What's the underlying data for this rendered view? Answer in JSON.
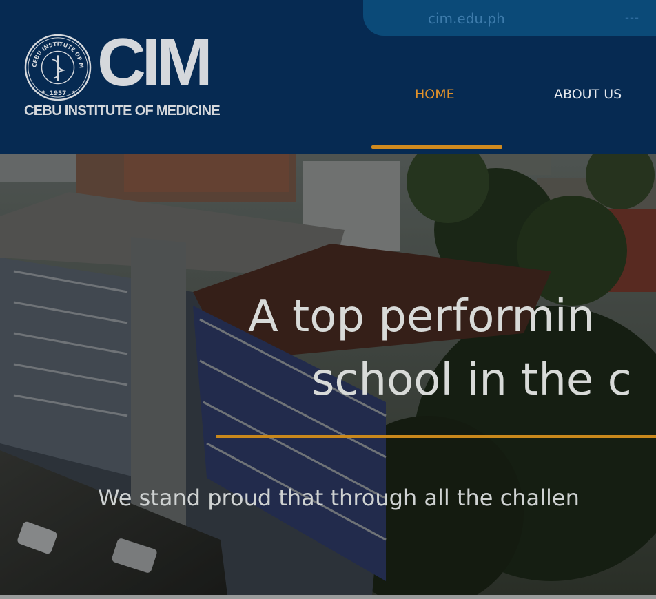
{
  "topbar": {
    "domain": "cim.edu.ph",
    "extra": "---"
  },
  "logo": {
    "brand": "CIM",
    "subtitle": "CEBU INSTITUTE OF MEDICINE",
    "seal_text": "CEBU INSTITUTE OF MEDICINE",
    "seal_year": "1957"
  },
  "nav": {
    "items": [
      {
        "label": "HOME",
        "active": true
      },
      {
        "label": "ABOUT US",
        "active": false
      }
    ]
  },
  "hero": {
    "title_line1": "A top performin",
    "title_line2": "school in the c",
    "subtitle": "We stand proud that through all the challen"
  },
  "colors": {
    "header_bg": "#062a52",
    "accent": "#d08a1f",
    "nav_active": "#e2922a"
  }
}
